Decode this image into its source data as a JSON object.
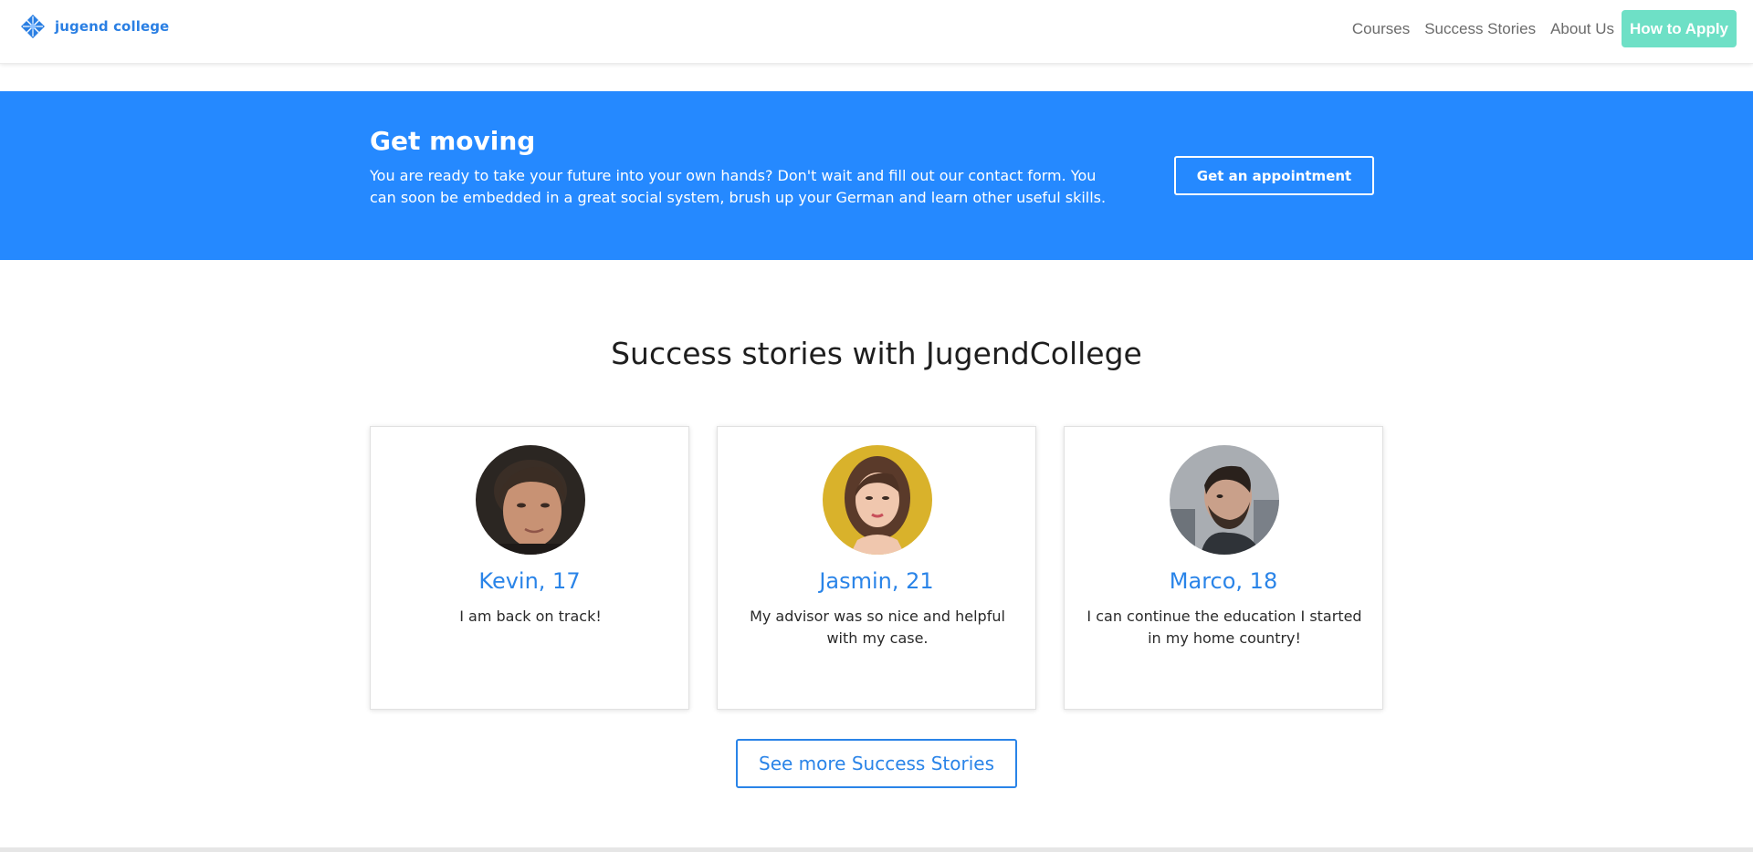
{
  "header": {
    "logo_text": "jugend college",
    "nav": {
      "courses": "Courses",
      "success_stories": "Success Stories",
      "about_us": "About Us",
      "how_to_apply": "How to Apply"
    }
  },
  "banner": {
    "title": "Get moving",
    "text": "You are ready to take your future into your own hands? Don't wait and fill out our contact form. You can soon be embedded in a great social system, brush up your German and learn other useful skills.",
    "button_label": "Get an appointment"
  },
  "success": {
    "title": "Success stories with JugendCollege",
    "stories": [
      {
        "name": "Kevin, 17",
        "quote": "I am back on track!"
      },
      {
        "name": "Jasmin, 21",
        "quote": "My advisor was so nice and helpful with my case."
      },
      {
        "name": "Marco, 18",
        "quote": "I can continue the education I started in my home country!"
      }
    ],
    "more_button_label": "See more Success Stories"
  },
  "colors": {
    "brand_blue": "#2589ff",
    "accent_blue": "#2a84e8",
    "apply_green": "#6ee0c6"
  },
  "icons": {
    "logo": "diamond-grid-logo-icon"
  }
}
